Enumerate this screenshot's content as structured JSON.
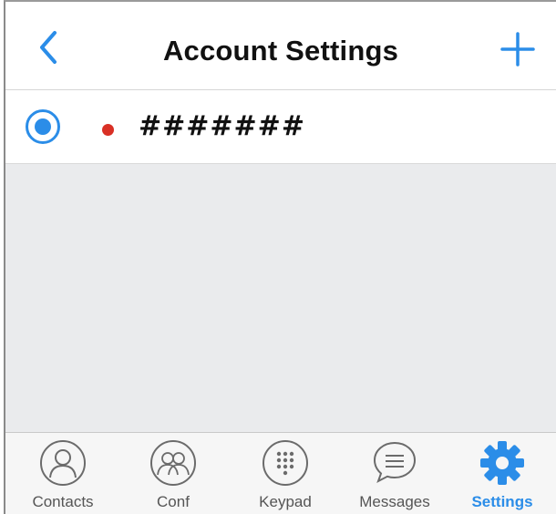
{
  "header": {
    "title": "Account Settings",
    "back_icon": "chevron-left-icon",
    "add_icon": "plus-icon"
  },
  "accounts": [
    {
      "name": "#######",
      "selected": true,
      "status_color": "#d93025"
    }
  ],
  "tabbar": {
    "tabs": [
      {
        "label": "Contacts",
        "icon": "contacts-icon",
        "active": false
      },
      {
        "label": "Conf",
        "icon": "conference-icon",
        "active": false
      },
      {
        "label": "Keypad",
        "icon": "keypad-icon",
        "active": false
      },
      {
        "label": "Messages",
        "icon": "messages-icon",
        "active": false
      },
      {
        "label": "Settings",
        "icon": "settings-gear-icon",
        "active": true
      }
    ]
  },
  "colors": {
    "accent": "#2b8de8",
    "status_offline": "#d93025",
    "background": "#eaebed",
    "tab_inactive": "#555555"
  }
}
